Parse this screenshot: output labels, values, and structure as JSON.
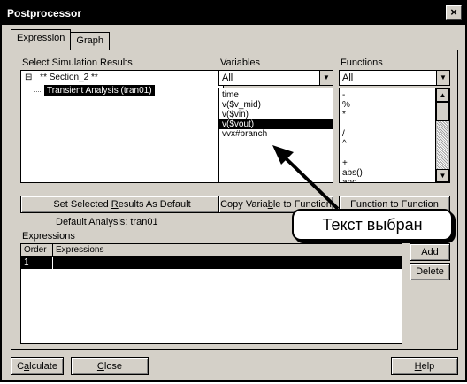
{
  "window": {
    "title": "Postprocessor",
    "close_symbol": "×"
  },
  "tabs": [
    {
      "label": "Expression",
      "active": true
    },
    {
      "label": "Graph",
      "active": false
    }
  ],
  "simulation": {
    "label": "Select Simulation Results",
    "tree_root": "** Section_2 **",
    "tree_toggle": "⊟",
    "tree_child": "Transient Analysis (tran01)",
    "set_default_pre": "Set Selected ",
    "set_default_mn": "R",
    "set_default_post": "esults As Default",
    "default_text": "Default Analysis: tran01"
  },
  "variables": {
    "label": "Variables",
    "filter_value": "All",
    "items": [
      "time",
      "v($v_mid)",
      "v($vin)",
      "v($vout)",
      "vvx#branch"
    ],
    "selected_index": 3,
    "copy_pre": "Copy Varia",
    "copy_mn": "b",
    "copy_post": "le to Function"
  },
  "functions": {
    "label": "Functions",
    "filter_value": "All",
    "items": [
      "-",
      "%",
      "*",
      "",
      "/",
      "^",
      "",
      "+",
      "abs()",
      "and"
    ],
    "button_label": "Function to Function"
  },
  "callout": {
    "text": "Текст выбран"
  },
  "expressions": {
    "label": "Expressions",
    "columns": [
      "Order",
      "Expressions"
    ],
    "rows": [
      {
        "order": "1",
        "expression": ""
      }
    ],
    "add_label": "Add",
    "delete_label": "Delete"
  },
  "footer": {
    "calculate_pre": "C",
    "calculate_mn": "a",
    "calculate_post": "lculate",
    "close_mn": "C",
    "close_post": "lose",
    "help_mn": "H",
    "help_post": "elp"
  }
}
